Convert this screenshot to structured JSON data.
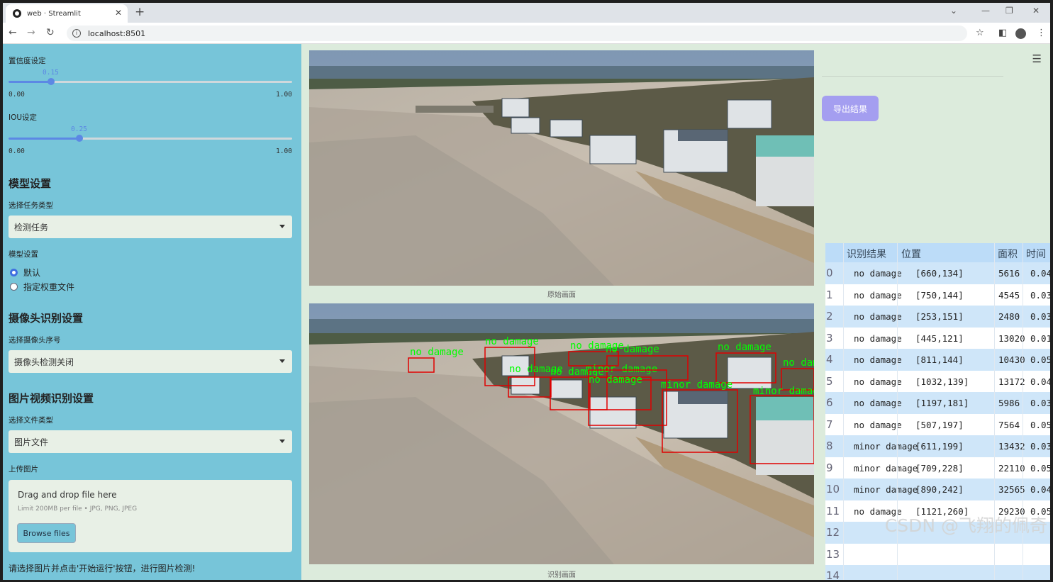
{
  "browser": {
    "tab_title": "web · Streamlit",
    "url": "localhost:8501"
  },
  "sidebar": {
    "conf_label": "置信度设定",
    "conf_value": "0.15",
    "conf_fraction": 0.15,
    "conf_min": "0.00",
    "conf_max": "1.00",
    "iou_label": "IOU设定",
    "iou_value": "0.25",
    "iou_fraction": 0.25,
    "iou_min": "0.00",
    "iou_max": "1.00",
    "model_header": "模型设置",
    "task_label": "选择任务类型",
    "task_value": "检测任务",
    "model_label": "模型设置",
    "radio_default": "默认",
    "radio_custom": "指定权重文件",
    "camera_header": "摄像头识别设置",
    "camera_label": "选择摄像头序号",
    "camera_value": "摄像头检测关闭",
    "media_header": "图片视频识别设置",
    "filetype_label": "选择文件类型",
    "filetype_value": "图片文件",
    "upload_label": "上传图片",
    "upload_drag": "Drag and drop file here",
    "upload_limit": "Limit 200MB per file • JPG, PNG, JPEG",
    "browse_button": "Browse files",
    "hint": "请选择图片并点击'开始运行'按钮，进行图片检测!"
  },
  "main": {
    "caption_original": "原始画面",
    "caption_detected": "识别画面",
    "export_button": "导出结果",
    "table_headers": [
      "识别结果",
      "位置",
      "面积",
      "时间"
    ],
    "rows": [
      [
        "0",
        "no damage",
        "[660,134]",
        "5616",
        "0.04"
      ],
      [
        "1",
        "no damage",
        "[750,144]",
        "4545",
        "0.03"
      ],
      [
        "2",
        "no damage",
        "[253,151]",
        "2480",
        "0.03"
      ],
      [
        "3",
        "no damage",
        "[445,121]",
        "13020",
        "0.01"
      ],
      [
        "4",
        "no damage",
        "[811,144]",
        "10430",
        "0.05"
      ],
      [
        "5",
        "no damage",
        "[1032,139]",
        "13172",
        "0.04"
      ],
      [
        "6",
        "no damage",
        "[1197,181]",
        "5986",
        "0.03"
      ],
      [
        "7",
        "no damage",
        "[507,197]",
        "7564",
        "0.05"
      ],
      [
        "8",
        "minor damage",
        "[611,199]",
        "13432",
        "0.03"
      ],
      [
        "9",
        "minor damage",
        "[709,228]",
        "22110",
        "0.05"
      ],
      [
        "10",
        "minor damage",
        "[890,242]",
        "32565",
        "0.04"
      ],
      [
        "11",
        "no damage",
        "[1121,260]",
        "29230",
        "0.05"
      ],
      [
        "12",
        "",
        "",
        "",
        ""
      ],
      [
        "13",
        "",
        "",
        "",
        ""
      ],
      [
        "14",
        "",
        "",
        "",
        ""
      ]
    ],
    "detections": [
      {
        "label": "no damage"
      },
      {
        "label": "no damage"
      },
      {
        "label": "no damage"
      },
      {
        "label": "no damage"
      },
      {
        "label": "no damage"
      },
      {
        "label": "no damage"
      },
      {
        "label": "no damage"
      },
      {
        "label": "no damage"
      },
      {
        "label": "minor damage"
      },
      {
        "label": "minor damage"
      },
      {
        "label": "minor damage"
      },
      {
        "label": "no damage"
      }
    ]
  },
  "watermark": "CSDN @飞翔的佩奇",
  "colors": {
    "sidebar_bg": "#77c5d9",
    "main_bg": "#dcebdc",
    "accent": "#5c88e4",
    "export_button": "#a49ef0",
    "box_stroke": "#e00000",
    "box_label": "#00ff00"
  }
}
